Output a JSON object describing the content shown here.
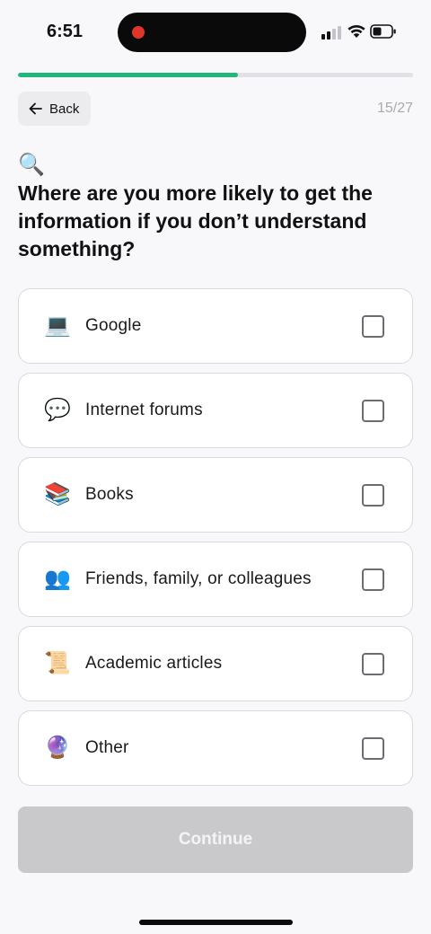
{
  "status_bar": {
    "time": "6:51",
    "recording_color": "#e0352b"
  },
  "progress": {
    "current": 15,
    "total": 27,
    "fraction": 0.556,
    "fill_color": "#1fb77b"
  },
  "nav": {
    "back_label": "Back",
    "step_counter": "15/27"
  },
  "question": {
    "icon": "magnifying-glass-icon",
    "icon_glyph": "🔍",
    "text": "Where are you more likely to get the information if you don’t understand something?"
  },
  "options": [
    {
      "icon": "laptop-icon",
      "glyph": "💻",
      "label": "Google",
      "checked": false
    },
    {
      "icon": "speech-bubble-icon",
      "glyph": "💬",
      "label": "Internet forums",
      "checked": false
    },
    {
      "icon": "books-icon",
      "glyph": "📚",
      "label": "Books",
      "checked": false
    },
    {
      "icon": "people-icon",
      "glyph": "👥",
      "label": "Friends, family, or colleagues",
      "checked": false
    },
    {
      "icon": "scroll-icon",
      "glyph": "📜",
      "label": "Academic articles",
      "checked": false
    },
    {
      "icon": "crystal-ball-icon",
      "glyph": "🔮",
      "label": "Other",
      "checked": false
    }
  ],
  "continue": {
    "label": "Continue",
    "disabled": true
  }
}
